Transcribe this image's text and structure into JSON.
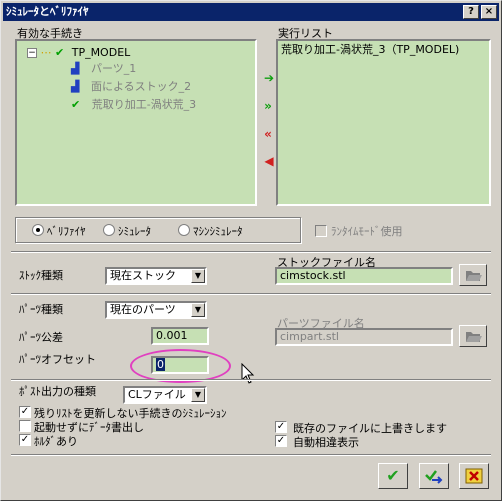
{
  "window": {
    "title": "ｼﾐｭﾚｰﾀとﾍﾞﾘﾌｧｲﾔ",
    "help_button": "?",
    "close_button": "×"
  },
  "procedures": {
    "label": "有効な手続き",
    "tree": {
      "toggle": "−",
      "root": "TP_MODEL",
      "children": [
        "パーツ_1",
        "面によるストック_2",
        "荒取り加工-渦状荒_3"
      ]
    }
  },
  "exec_list": {
    "label": "実行リスト",
    "items": [
      "荒取り加工-渦状荒_3（TP_MODEL)"
    ]
  },
  "arrows": [
    "add",
    "add-all",
    "remove-all",
    "remove"
  ],
  "mode": {
    "options": [
      "ﾍﾞﾘﾌｧｲﾔ",
      "ｼﾐｭﾚｰﾀ",
      "ﾏｼﾝｼﾐｭﾚｰﾀ"
    ],
    "selected_index": 0,
    "runtime_label": "ﾗﾝﾀｲﾑﾓｰﾄﾞ使用"
  },
  "stock": {
    "type_label": "ｽﾄｯｸ種類",
    "type_value": "現在ストック",
    "file_label": "ストックファイル名",
    "file_value": "cimstock.stl"
  },
  "part": {
    "type_label": "ﾊﾟｰﾂ種類",
    "type_value": "現在のパーツ",
    "tolerance_label": "ﾊﾟｰﾂ公差",
    "tolerance_value": "0.001",
    "offset_label": "ﾊﾟｰﾂオフセット",
    "offset_value": "0",
    "file_label": "パーツファイル名",
    "file_value": "cimpart.stl"
  },
  "post": {
    "type_label": "ﾎﾟｽﾄ出力の種類",
    "type_value": "CLファイル"
  },
  "options": {
    "opt1": "残りﾘｽﾄを更新しない手続きのｼﾐｭﾚｰｼｮﾝ",
    "opt2": "起動せずにﾃﾞｰﾀ書出し",
    "opt3": "ﾎﾙﾀﾞあり",
    "opt4": "既存のファイルに上書きします",
    "opt5": "自動相違表示"
  },
  "colors": {
    "list_bg": "#c6e0b4",
    "title_bg": "#0a246a",
    "highlight": "#e040c0"
  }
}
